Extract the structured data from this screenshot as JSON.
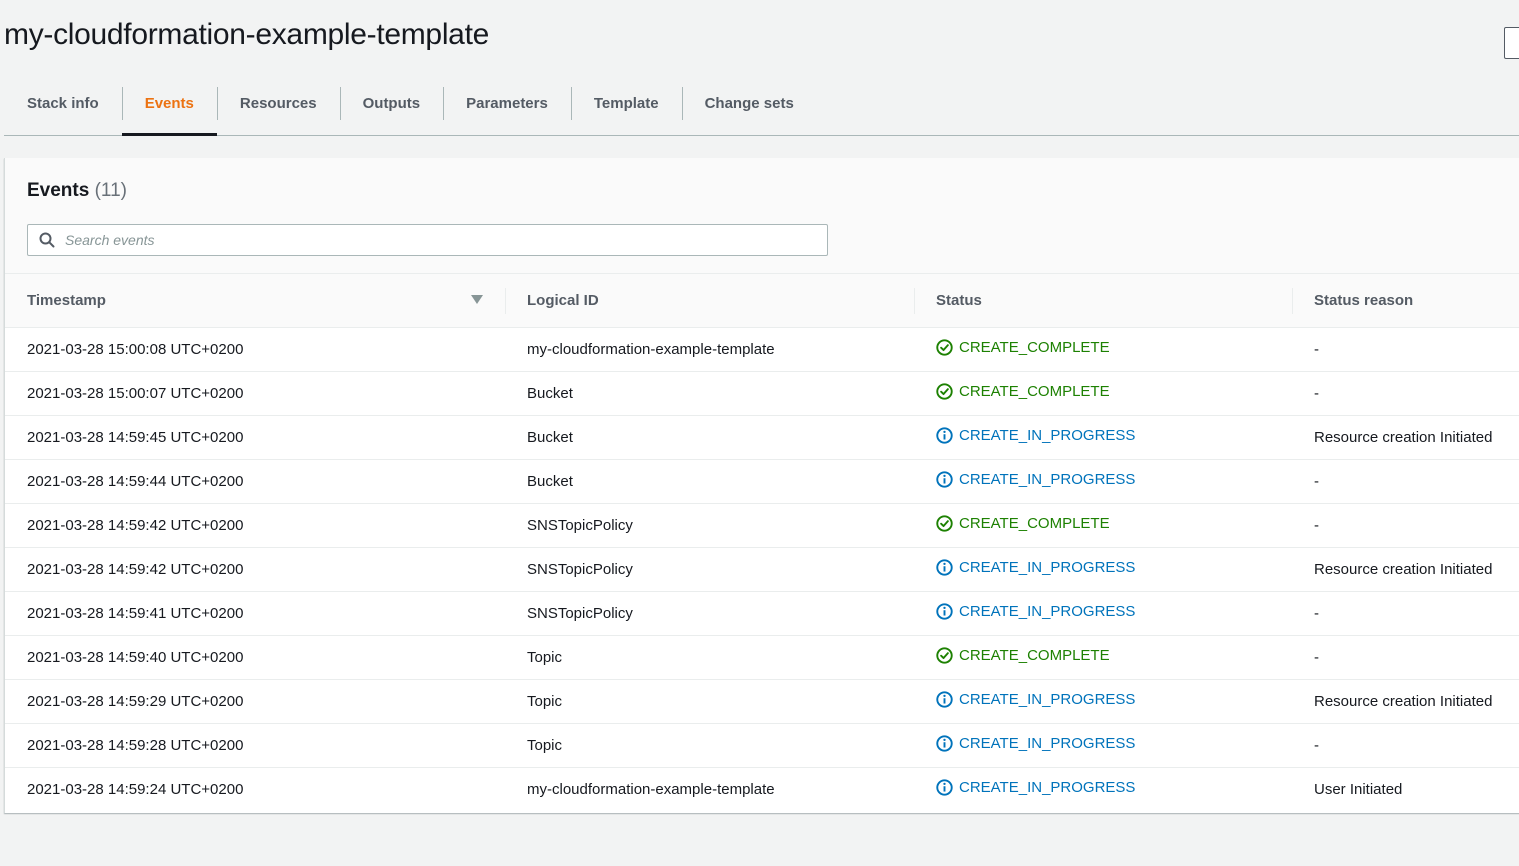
{
  "header": {
    "title": "my-cloudformation-example-template"
  },
  "tabs": [
    {
      "label": "Stack info",
      "active": false
    },
    {
      "label": "Events",
      "active": true
    },
    {
      "label": "Resources",
      "active": false
    },
    {
      "label": "Outputs",
      "active": false
    },
    {
      "label": "Parameters",
      "active": false
    },
    {
      "label": "Template",
      "active": false
    },
    {
      "label": "Change sets",
      "active": false
    }
  ],
  "events": {
    "title": "Events",
    "count": "(11)",
    "search": {
      "placeholder": "Search events",
      "value": ""
    },
    "columns": [
      "Timestamp",
      "Logical ID",
      "Status",
      "Status reason"
    ],
    "sort_column": "Timestamp",
    "sort_direction": "descending",
    "status_colors": {
      "CREATE_COMPLETE": "#1d8102",
      "CREATE_IN_PROGRESS": "#0073bb"
    },
    "rows": [
      {
        "timestamp": "2021-03-28 15:00:08 UTC+0200",
        "logical_id": "my-cloudformation-example-template",
        "status": "CREATE_COMPLETE",
        "status_icon": "check-circle-icon",
        "reason": "-"
      },
      {
        "timestamp": "2021-03-28 15:00:07 UTC+0200",
        "logical_id": "Bucket",
        "status": "CREATE_COMPLETE",
        "status_icon": "check-circle-icon",
        "reason": "-"
      },
      {
        "timestamp": "2021-03-28 14:59:45 UTC+0200",
        "logical_id": "Bucket",
        "status": "CREATE_IN_PROGRESS",
        "status_icon": "info-circle-icon",
        "reason": "Resource creation Initiated"
      },
      {
        "timestamp": "2021-03-28 14:59:44 UTC+0200",
        "logical_id": "Bucket",
        "status": "CREATE_IN_PROGRESS",
        "status_icon": "info-circle-icon",
        "reason": "-"
      },
      {
        "timestamp": "2021-03-28 14:59:42 UTC+0200",
        "logical_id": "SNSTopicPolicy",
        "status": "CREATE_COMPLETE",
        "status_icon": "check-circle-icon",
        "reason": "-"
      },
      {
        "timestamp": "2021-03-28 14:59:42 UTC+0200",
        "logical_id": "SNSTopicPolicy",
        "status": "CREATE_IN_PROGRESS",
        "status_icon": "info-circle-icon",
        "reason": "Resource creation Initiated"
      },
      {
        "timestamp": "2021-03-28 14:59:41 UTC+0200",
        "logical_id": "SNSTopicPolicy",
        "status": "CREATE_IN_PROGRESS",
        "status_icon": "info-circle-icon",
        "reason": "-"
      },
      {
        "timestamp": "2021-03-28 14:59:40 UTC+0200",
        "logical_id": "Topic",
        "status": "CREATE_COMPLETE",
        "status_icon": "check-circle-icon",
        "reason": "-"
      },
      {
        "timestamp": "2021-03-28 14:59:29 UTC+0200",
        "logical_id": "Topic",
        "status": "CREATE_IN_PROGRESS",
        "status_icon": "info-circle-icon",
        "reason": "Resource creation Initiated"
      },
      {
        "timestamp": "2021-03-28 14:59:28 UTC+0200",
        "logical_id": "Topic",
        "status": "CREATE_IN_PROGRESS",
        "status_icon": "info-circle-icon",
        "reason": "-"
      },
      {
        "timestamp": "2021-03-28 14:59:24 UTC+0200",
        "logical_id": "my-cloudformation-example-template",
        "status": "CREATE_IN_PROGRESS",
        "status_icon": "info-circle-icon",
        "reason": "User Initiated"
      }
    ]
  }
}
